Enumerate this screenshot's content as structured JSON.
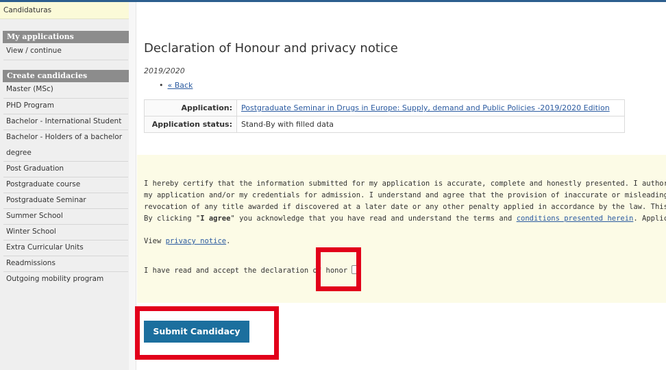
{
  "sidebar": {
    "top_label": "Candidaturas",
    "sections": [
      {
        "heading": "My applications",
        "items": [
          {
            "label": "View / continue"
          }
        ]
      },
      {
        "heading": "Create candidacies",
        "items": [
          {
            "label": "Master (MSc)"
          },
          {
            "label": "PHD Program"
          },
          {
            "label": "Bachelor - International Student"
          },
          {
            "label": "Bachelor - Holders of a bachelor"
          },
          {
            "label": "degree"
          },
          {
            "label": "Post Graduation"
          },
          {
            "label": "Postgraduate course"
          },
          {
            "label": "Postgraduate Seminar"
          },
          {
            "label": "Summer School"
          },
          {
            "label": "Winter School"
          },
          {
            "label": "Extra Curricular Units"
          },
          {
            "label": "Readmissions"
          },
          {
            "label": "Outgoing mobility program"
          }
        ]
      }
    ]
  },
  "main": {
    "title": "Declaration of Honour and privacy notice",
    "year": "2019/2020",
    "back_label": "« Back",
    "application_label": "Application:",
    "application_value": "Postgraduate Seminar in Drugs in Europe: Supply, demand and Public Policies -2019/2020 Edition",
    "status_label": "Application status:",
    "status_value": "Stand-By with filled data",
    "declaration": {
      "line1": "I hereby certify that the information submitted for my application is accurate, complete and honestly presented. I authorize all perso",
      "line2": "my application and/or my credentials for admission. I understand and agree that the provision of inaccurate or misleading informatio",
      "line3": "revocation of any title awarded if discovered at a later date or any other penalty applied in accordance by the law. This application is",
      "line4_pre": "By clicking \"",
      "line4_bold": "I agree",
      "line4_mid": "\" you acknowledge that you have read and understand the terms and ",
      "line4_link": "conditions presented herein",
      "line4_post": ". Applications w",
      "privacy_pre": "View ",
      "privacy_link": "privacy notice",
      "privacy_post": ".",
      "accept_label": "I have read and accept the declaration of honor",
      "accept_checked": false
    },
    "submit_label": "Submit Candidacy"
  },
  "colors": {
    "accent": "#1c6f9e",
    "highlight": "#e2001a",
    "link": "#2a5aa0",
    "panel_bg": "#fcfbe6"
  }
}
